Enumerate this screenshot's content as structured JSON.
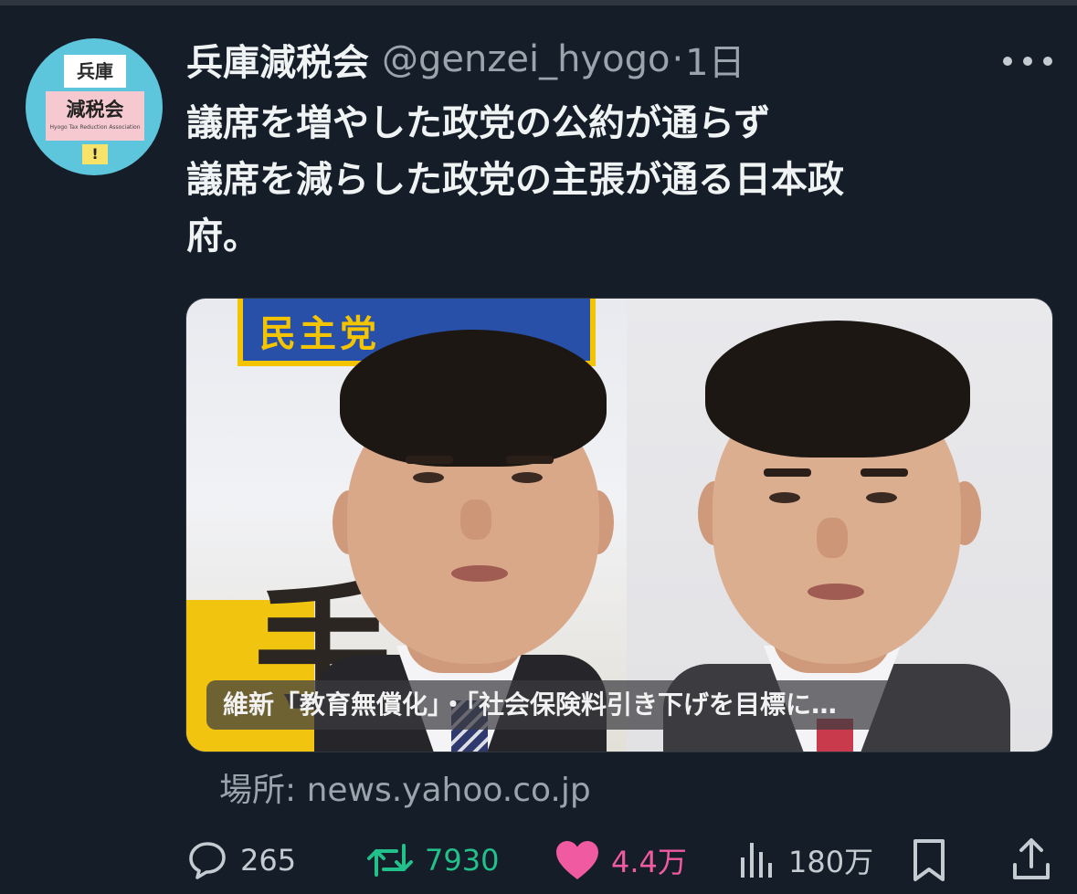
{
  "account": {
    "display_name": "兵庫減税会",
    "handle": "@genzei_hyogo",
    "separator": "·",
    "time": "1日",
    "avatar": {
      "line1": "兵庫",
      "line2": "減税会",
      "subline": "Hyogo Tax Reduction Association",
      "mark": "!"
    }
  },
  "tweet": {
    "lines": [
      "議席を増やした政党の公約が通らず",
      "議席を減らした政党の主張が通る日本政",
      "府。"
    ]
  },
  "media": {
    "caption": "維新「教育無償化」・「社会保険料引き下げを目標に…",
    "banner_text": "民主党",
    "background_char": "手"
  },
  "source": {
    "text": "場所: news.yahoo.co.jp"
  },
  "actions": {
    "reply_count": "265",
    "retweet_count": "7930",
    "like_count": "4.4万",
    "view_count": "180万"
  },
  "colors": {
    "background": "#151d28",
    "retweet": "#22c08b",
    "like": "#f05aa0",
    "muted": "#9aa4ad"
  },
  "icons": [
    "more-icon",
    "reply-icon",
    "retweet-icon",
    "like-icon",
    "views-icon",
    "bookmark-icon",
    "share-icon"
  ]
}
